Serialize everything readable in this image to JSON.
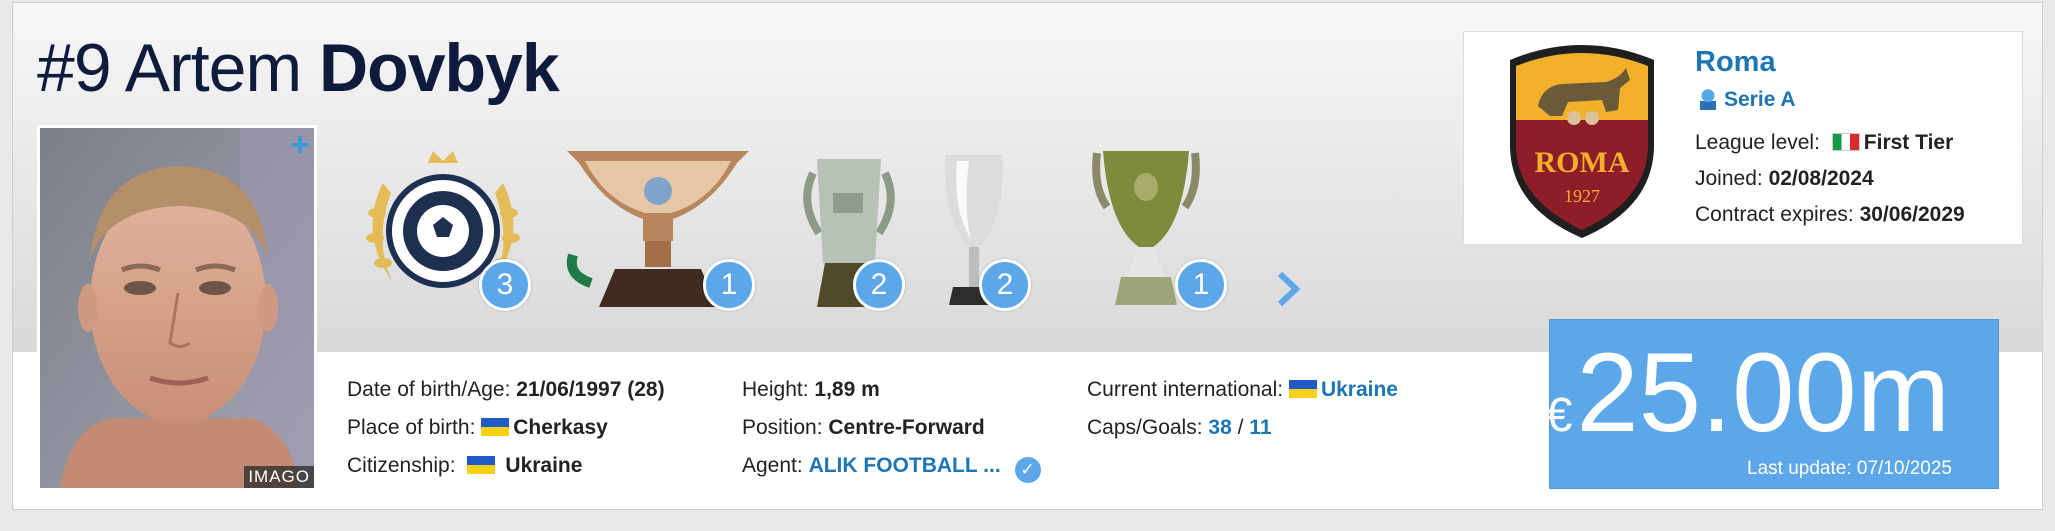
{
  "player": {
    "number": "#9",
    "first_name": "Artem",
    "last_name": "Dovbyk"
  },
  "photo": {
    "plus_icon": "+",
    "credit": "IMAGO"
  },
  "trophies": [
    {
      "icon": "laurel-ball-icon",
      "count": "3"
    },
    {
      "icon": "cup-icon",
      "count": "1"
    },
    {
      "icon": "two-handled-cup-icon",
      "count": "2"
    },
    {
      "icon": "small-cup-icon",
      "count": "2"
    },
    {
      "icon": "green-cup-icon",
      "count": "1"
    }
  ],
  "trophies_next_icon": "chevron-right-icon",
  "info": {
    "dob_label": "Date of birth/Age:",
    "dob_value": "21/06/1997 (28)",
    "pob_label": "Place of birth:",
    "pob_value": "Cherkasy",
    "citizenship_label": "Citizenship:",
    "citizenship_value": "Ukraine",
    "height_label": "Height:",
    "height_value": "1,89 m",
    "position_label": "Position:",
    "position_value": "Centre-Forward",
    "agent_label": "Agent:",
    "agent_value": "ALIK FOOTBALL ...",
    "international_label": "Current international:",
    "international_value": "Ukraine",
    "caps_label": "Caps/Goals:",
    "caps_value": "38",
    "caps_sep": "/",
    "goals_value": "11"
  },
  "club": {
    "name": "Roma",
    "crest_text": "ROMA",
    "crest_year": "1927",
    "league": "Serie A",
    "level_label": "League level:",
    "level_value": "First Tier",
    "joined_label": "Joined:",
    "joined_value": "02/08/2024",
    "contract_label": "Contract expires:",
    "contract_value": "30/06/2029"
  },
  "market_value": {
    "currency": "€",
    "amount": "25.00m",
    "update": "Last update: 07/10/2025"
  },
  "colors": {
    "accent_blue": "#5ba7ea",
    "link_blue": "#1d75b3",
    "title_navy": "#0f1b3d"
  }
}
